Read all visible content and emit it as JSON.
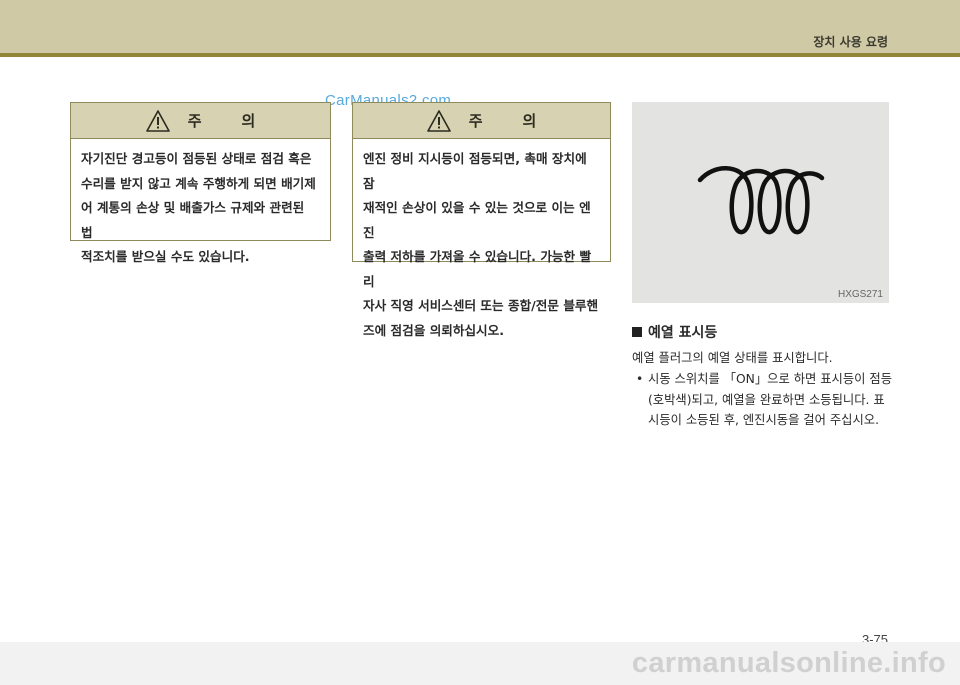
{
  "header": {
    "section_title": "장치 사용 요령"
  },
  "watermark_top": "CarManuals2.com",
  "cautions": [
    {
      "title_parts": [
        "주",
        "의"
      ],
      "lines": [
        "자기진단 경고등이 점등된 상태로 점검 혹은",
        "수리를 받지 않고 계속 주행하게 되면 배기제",
        "어 계통의 손상 및 배출가스 규제와 관련된 법",
        "적조치를 받으실 수도 있습니다."
      ]
    },
    {
      "title_parts": [
        "주",
        "의"
      ],
      "lines": [
        "엔진 정비 지시등이 점등되면, 촉매 장치에 잠",
        "재적인 손상이 있을 수 있는 것으로 이는 엔진",
        "출력 저하를 가져올 수 있습니다. 가능한 빨리",
        "자사 직영 서비스센터 또는 종합/전문 블루핸",
        "즈에 점검을 의뢰하십시오."
      ]
    }
  ],
  "figure": {
    "image_code": "HXGS271",
    "icon": "glow-plug-coil-icon"
  },
  "section": {
    "heading": "예열 표시등",
    "description": "예열 플러그의 예열 상태를 표시합니다.",
    "bullet_lines": [
      "시동 스위치를 「ON」으로 하면 표시등이 점등",
      "(호박색)되고, 예열을 완료하면 소등됩니다. 표",
      "시등이 소등된 후, 엔진시동을 걸어 주십시오."
    ],
    "bullet_marker": "•"
  },
  "page_number": "3-75",
  "watermark_bottom": "carmanualsonline.info",
  "colors": {
    "header_band": "#cfc9a6",
    "header_line": "#8f8737",
    "caution_head": "#d7d2b1",
    "panel_bg": "#e3e3e1"
  }
}
